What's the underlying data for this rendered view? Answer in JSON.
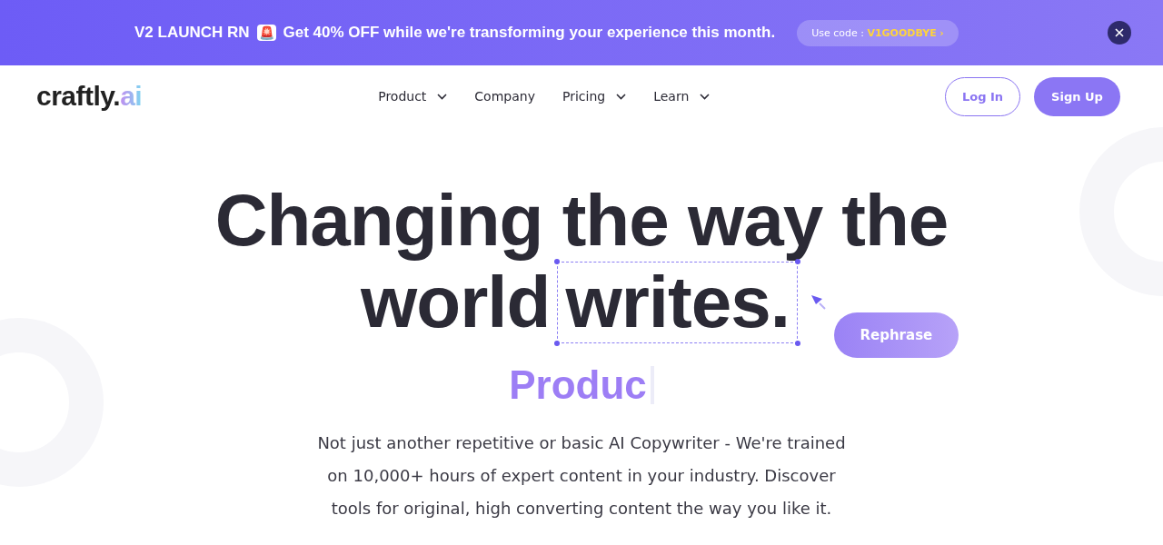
{
  "banner": {
    "headline": "V2 LAUNCH RN",
    "emoji": "🚨",
    "message": "Get 40% OFF while we're transforming your experience this month.",
    "code_label": "Use code :",
    "code": "V1GOODBYE",
    "code_arrow": "›"
  },
  "logo": {
    "text": "craftly.",
    "accent": "ai"
  },
  "nav": [
    {
      "label": "Product",
      "has_menu": true
    },
    {
      "label": "Company",
      "has_menu": false
    },
    {
      "label": "Pricing",
      "has_menu": true
    },
    {
      "label": "Learn",
      "has_menu": true
    }
  ],
  "auth": {
    "login": "Log In",
    "signup": "Sign Up"
  },
  "hero": {
    "line1": "Changing the way the",
    "line2_start": "world",
    "selected_word": "writes.",
    "rephrase": "Rephrase",
    "typed": "Produc",
    "description": "Not just another repetitive or basic AI Copywriter - We're trained on 10,000+ hours of expert content in your industry. Discover tools for original, high converting content the way you like it."
  }
}
